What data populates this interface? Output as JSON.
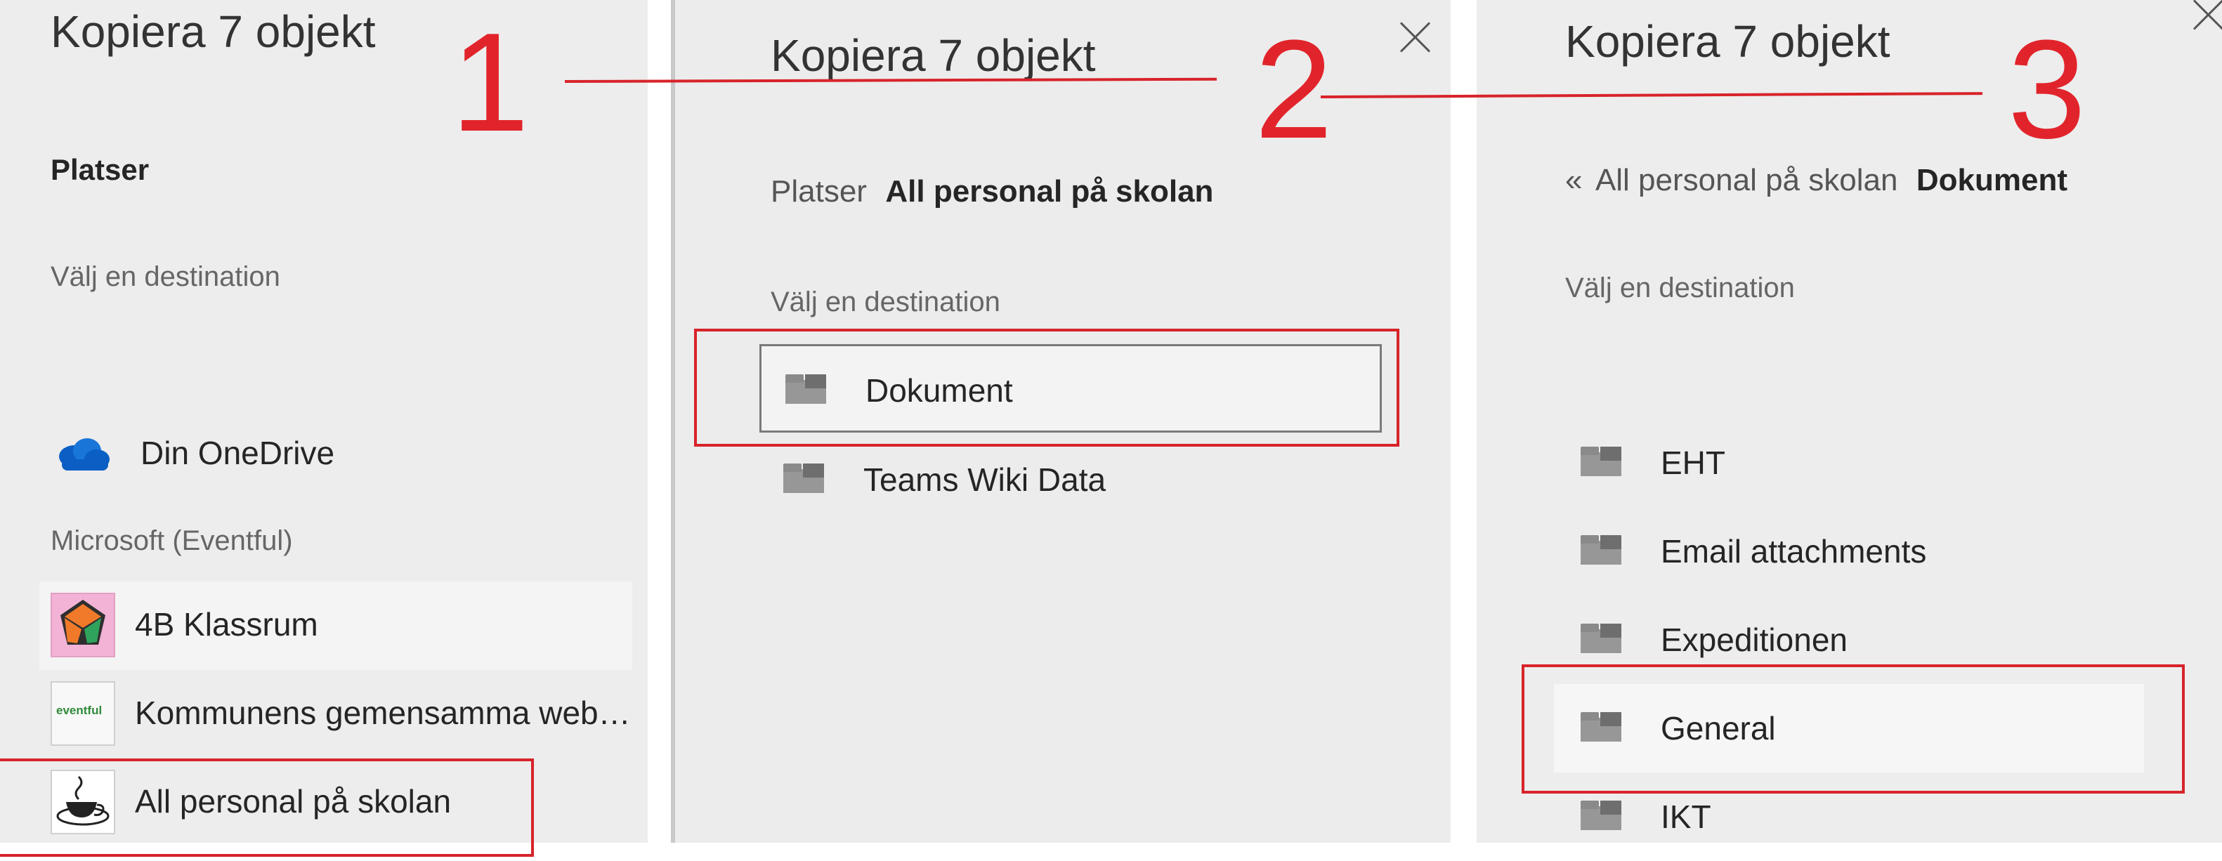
{
  "step_numbers": {
    "one": "1",
    "two": "2",
    "three": "3"
  },
  "panel1": {
    "title": "Kopiera 7 objekt",
    "section_label": "Platser",
    "instruction": "Välj en destination",
    "onedrive_label": "Din OneDrive",
    "group_label": "Microsoft (Eventful)",
    "sites": [
      {
        "label": "4B Klassrum",
        "icon": "dodecahedron-logo"
      },
      {
        "label": "Kommunens gemensamma web…",
        "icon": "eventful-logo",
        "logo_text": "eventful"
      },
      {
        "label": "All personal på skolan",
        "icon": "coffee-cup-logo"
      }
    ]
  },
  "panel2": {
    "title": "Kopiera 7 objekt",
    "breadcrumb": {
      "root": "Platser",
      "current": "All personal på skolan"
    },
    "instruction": "Välj en destination",
    "folders": [
      {
        "label": "Dokument",
        "icon": "folder-icon",
        "selected": true
      },
      {
        "label": "Teams Wiki Data",
        "icon": "folder-icon",
        "selected": false
      }
    ]
  },
  "panel3": {
    "title": "Kopiera 7 objekt",
    "breadcrumb": {
      "back": "All personal på skolan",
      "current": "Dokument"
    },
    "instruction": "Välj en destination",
    "folders": [
      {
        "label": "EHT",
        "icon": "folder-icon"
      },
      {
        "label": "Email attachments",
        "icon": "folder-icon"
      },
      {
        "label": "Expeditionen",
        "icon": "folder-icon"
      },
      {
        "label": "General",
        "icon": "folder-icon",
        "selected": true
      },
      {
        "label": "IKT",
        "icon": "folder-icon"
      }
    ]
  },
  "colors": {
    "annotation_red": "#d8232a",
    "panel_background": "#ededed",
    "onedrive_blue": "#0b5fc4"
  }
}
